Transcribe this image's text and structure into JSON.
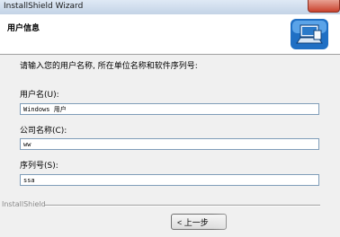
{
  "window": {
    "title": "InstallShield Wizard"
  },
  "header": {
    "title": "用户信息",
    "logo_icon": "computer-install-icon"
  },
  "instruction": "请输入您的用户名称, 所在单位名称和软件序列号:",
  "fields": [
    {
      "label": "用户名(U):",
      "value": "Windows 用户"
    },
    {
      "label": "公司名称(C):",
      "value": "ww"
    },
    {
      "label": "序列号(S):",
      "value": "ssa"
    }
  ],
  "footer": {
    "brand": "InstallShield",
    "back_button": "< 上一步"
  }
}
